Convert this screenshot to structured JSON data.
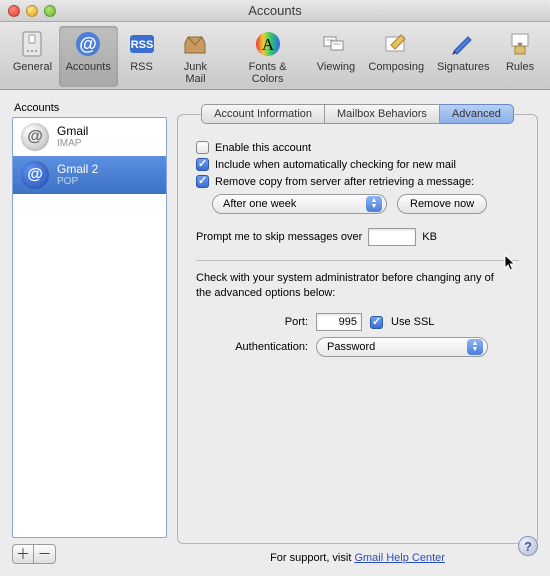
{
  "window": {
    "title": "Accounts"
  },
  "toolbar": {
    "items": [
      {
        "label": "General"
      },
      {
        "label": "Accounts"
      },
      {
        "label": "RSS"
      },
      {
        "label": "Junk Mail"
      },
      {
        "label": "Fonts & Colors"
      },
      {
        "label": "Viewing"
      },
      {
        "label": "Composing"
      },
      {
        "label": "Signatures"
      },
      {
        "label": "Rules"
      }
    ],
    "selected_index": 1
  },
  "sidebar": {
    "title": "Accounts",
    "items": [
      {
        "name": "Gmail",
        "type": "IMAP"
      },
      {
        "name": "Gmail 2",
        "type": "POP"
      }
    ],
    "selected_index": 1,
    "add_glyph": "＋",
    "remove_glyph": "－"
  },
  "tabs": {
    "items": [
      {
        "label": "Account Information"
      },
      {
        "label": "Mailbox Behaviors"
      },
      {
        "label": "Advanced"
      }
    ],
    "selected_index": 2
  },
  "advanced": {
    "enable_label": "Enable this account",
    "enable_checked": false,
    "include_label": "Include when automatically checking for new mail",
    "include_checked": true,
    "remove_label": "Remove copy from server after retrieving a message:",
    "remove_checked": true,
    "remove_after_value": "After one week",
    "remove_now_label": "Remove now",
    "prompt_prefix": "Prompt me to skip messages over",
    "prompt_value": "",
    "prompt_suffix": "KB",
    "admin_note": "Check with your system administrator before changing any of the advanced options below:",
    "port_label": "Port:",
    "port_value": "995",
    "use_ssl_label": "Use SSL",
    "use_ssl_checked": true,
    "auth_label": "Authentication:",
    "auth_value": "Password"
  },
  "footer": {
    "support_prefix": "For support, visit ",
    "support_link": "Gmail Help Center",
    "help_glyph": "?"
  }
}
